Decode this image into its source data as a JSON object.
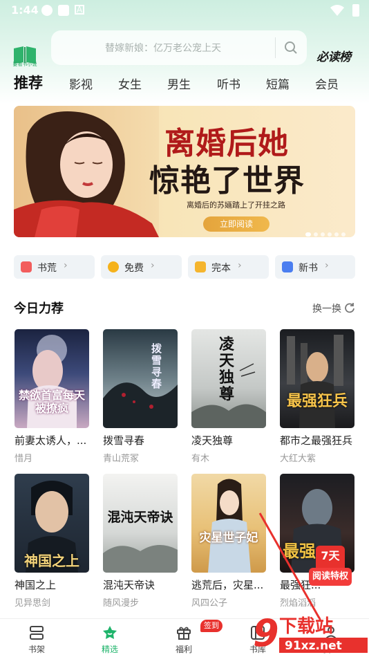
{
  "status_bar": {
    "time": "1:44"
  },
  "header": {
    "logo_label": "要看书小说",
    "search_placeholder": "替嫁新娘：亿万老公宠上天",
    "must_read": "必读榜"
  },
  "tabs": [
    "推荐",
    "影视",
    "女生",
    "男生",
    "听书",
    "短篇",
    "会员"
  ],
  "banner": {
    "title_line1": "离婚后她",
    "title_line2": "惊艳了世界",
    "subtitle": "离婚后的苏婳踏上了开挂之路",
    "button": "立即阅读"
  },
  "categories": [
    {
      "label": "书荒",
      "color": "#f25d5d"
    },
    {
      "label": "免费",
      "color": "#f5b21c"
    },
    {
      "label": "完本",
      "color": "#f5b52e"
    },
    {
      "label": "新书",
      "color": "#4b7ef0"
    }
  ],
  "section": {
    "title": "今日力荐",
    "refresh": "换一换"
  },
  "books": [
    {
      "title": "前妻太诱人，...",
      "author": "惜月",
      "cover_text": "禁欲首富每天被撩疯"
    },
    {
      "title": "拨雪寻春",
      "author": "青山荒冢",
      "cover_text": "拨雪寻春"
    },
    {
      "title": "凌天独尊",
      "author": "有木",
      "cover_text": "凌天独尊"
    },
    {
      "title": "都市之最强狂兵",
      "author": "大红大紫",
      "cover_text": "最强狂兵"
    },
    {
      "title": "神国之上",
      "author": "见异思剑",
      "cover_text": "神国之上"
    },
    {
      "title": "混沌天帝诀",
      "author": "随风漫步",
      "cover_text": "混沌天帝诀"
    },
    {
      "title": "逃荒后，灾星...",
      "author": "风四公子",
      "cover_text": "灾星世子妃"
    },
    {
      "title": "最强狂...",
      "author": "烈焰滔滔",
      "cover_text": "最强"
    }
  ],
  "promo": {
    "days": "7天",
    "label": "阅读特权"
  },
  "bottom_nav": [
    {
      "label": "书架"
    },
    {
      "label": "精选"
    },
    {
      "label": "福利"
    },
    {
      "label": "书库"
    },
    {
      "label": "我的"
    }
  ],
  "sign_badge": "签到",
  "watermark": {
    "text": "下载站",
    "site": "91xz.net"
  },
  "colors": {
    "accent": "#1fb46b",
    "red": "#e8312d"
  }
}
